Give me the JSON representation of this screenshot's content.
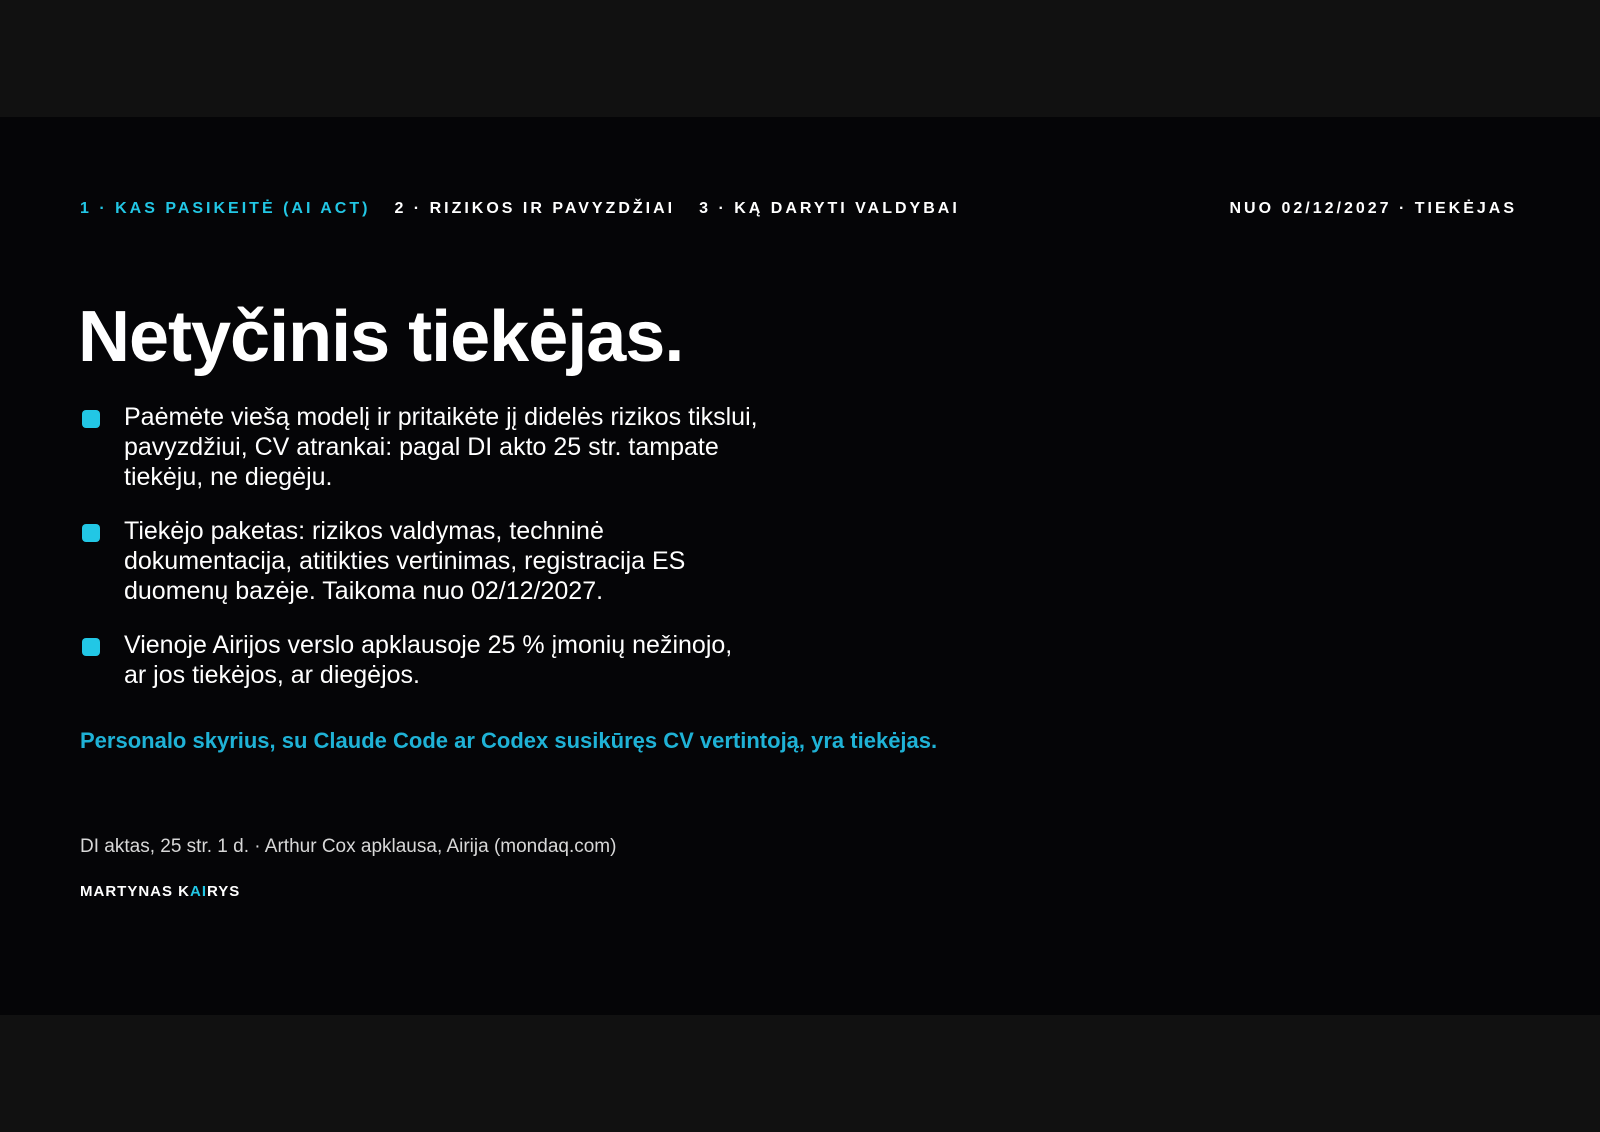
{
  "colors": {
    "accent": "#22c7e5",
    "accent_text": "#1fb2d6",
    "background": "#050507",
    "frame": "#111111"
  },
  "nav": {
    "items": [
      {
        "label": "1 · KAS PASIKEITĖ (AI ACT)",
        "active": true
      },
      {
        "label": "2 · RIZIKOS IR PAVYZDŽIAI",
        "active": false
      },
      {
        "label": "3 · KĄ DARYTI VALDYBAI",
        "active": false
      }
    ],
    "right_label": "NUO 02/12/2027 · TIEKĖJAS"
  },
  "title": "Netyčinis tiekėjas.",
  "bullets": [
    {
      "text": "Paėmėte viešą modelį ir pritaikėte jį didelės rizikos tikslui, pavyzdžiui, CV atrankai: pagal DI akto 25 str. tampate tiekėju, ne diegėju."
    },
    {
      "text": "Tiekėjo paketas: rizikos valdymas, techninė dokumentacija, atitikties vertinimas, registracija ES duomenų bazėje. Taikoma nuo 02/12/2027."
    },
    {
      "text": "Vienoje Airijos verslo apklausoje 25 % įmonių nežinojo, ar jos tiekėjos, ar diegėjos."
    }
  ],
  "highlight": "Personalo skyrius, su Claude Code ar Codex susikūręs CV vertintoją, yra tiekėjas.",
  "source": "DI aktas, 25 str. 1 d. · Arthur Cox apklausa, Airija (mondaq.com)",
  "author": {
    "part1": "MARTYNAS K",
    "part2": "AI",
    "part3": "RYS"
  }
}
